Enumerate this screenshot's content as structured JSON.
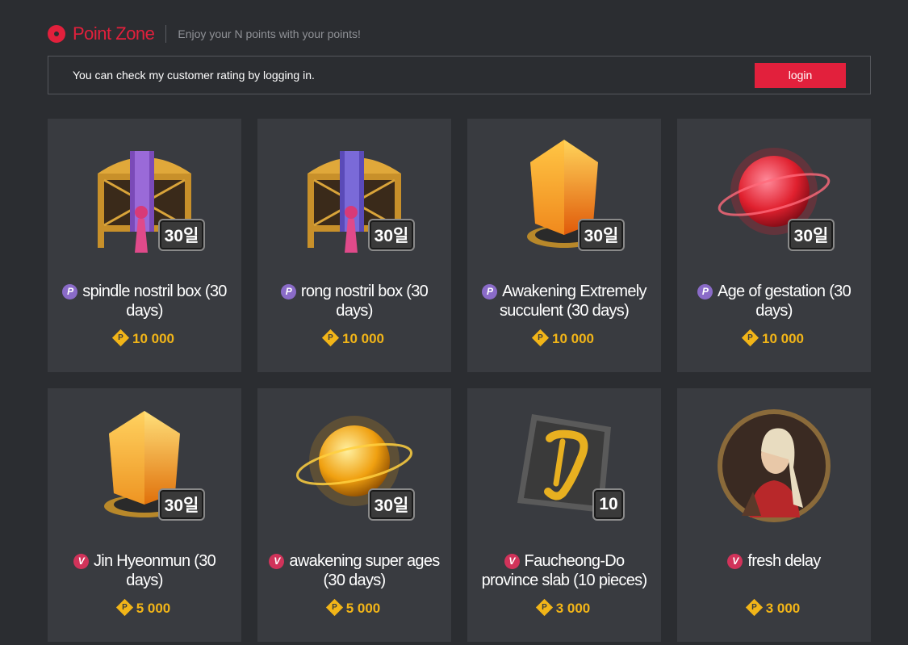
{
  "header": {
    "brand": "Point Zone",
    "tagline": "Enjoy your N points with your points!"
  },
  "login_bar": {
    "message": "You can check my customer rating by logging in.",
    "button_label": "login"
  },
  "products": [
    {
      "name": "spindle nostril box (30 days)",
      "currency": "P",
      "price": "10 000",
      "badge": "30일",
      "icon": "treasure-box-purple-icon"
    },
    {
      "name": "rong nostril box (30 days)",
      "currency": "P",
      "price": "10 000",
      "badge": "30일",
      "icon": "treasure-box-blue-icon"
    },
    {
      "name": "Awakening Extremely succulent (30 days)",
      "currency": "P",
      "price": "10 000",
      "badge": "30일",
      "icon": "orange-crystal-icon"
    },
    {
      "name": "Age of gestation (30 days)",
      "currency": "P",
      "price": "10 000",
      "badge": "30일",
      "icon": "red-orb-icon"
    },
    {
      "name": "Jin Hyeonmun (30 days)",
      "currency": "V",
      "price": "5 000",
      "badge": "30일",
      "icon": "golden-crystal-icon"
    },
    {
      "name": "awakening super ages (30 days)",
      "currency": "V",
      "price": "5 000",
      "badge": "30일",
      "icon": "golden-orb-icon"
    },
    {
      "name": "Faucheong-Do province slab (10 pieces)",
      "currency": "V",
      "price": "3 000",
      "badge": "10",
      "icon": "stone-slab-icon"
    },
    {
      "name": "fresh delay",
      "currency": "V",
      "price": "3 000",
      "badge": "",
      "icon": "character-portrait-icon"
    }
  ],
  "colors": {
    "accent": "#e2203c",
    "price": "#f2b518",
    "background": "#2b2d31",
    "card": "#393b40",
    "p_currency": "#8a6bc8",
    "v_currency": "#d1335a"
  }
}
